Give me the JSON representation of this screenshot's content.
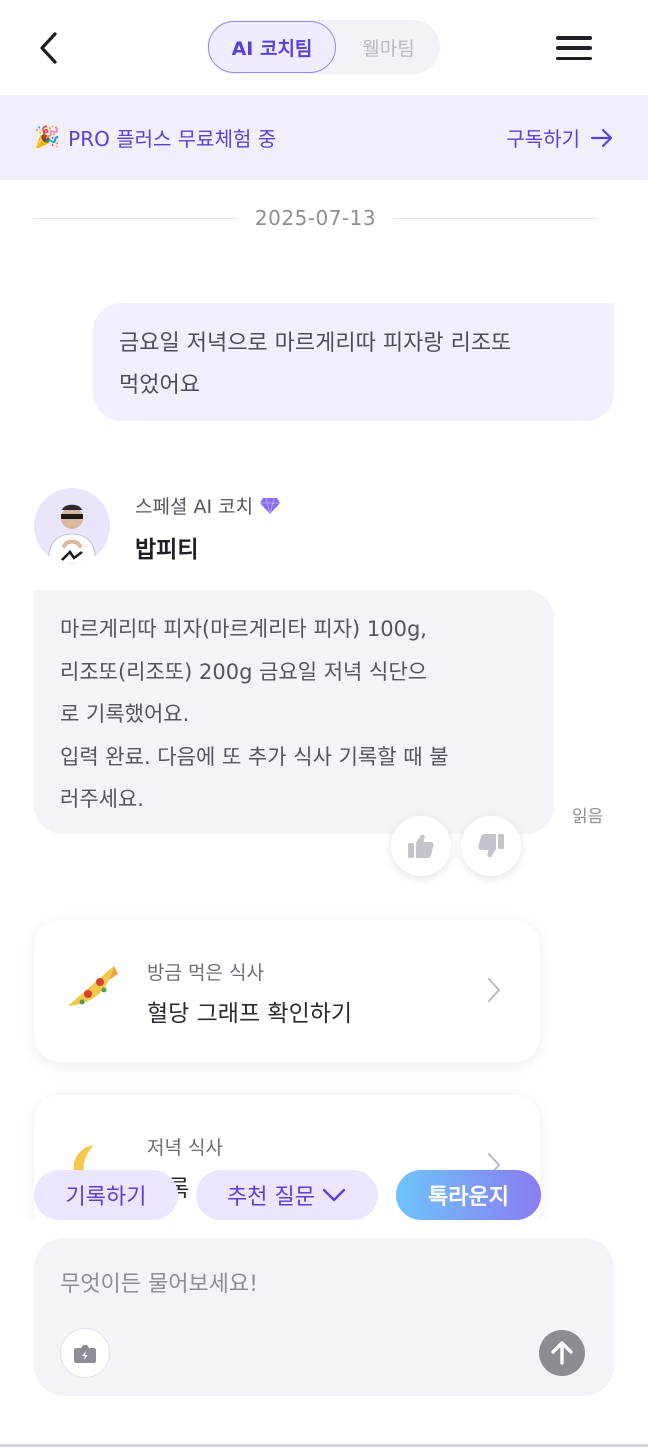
{
  "header": {
    "tabs": [
      {
        "label": "AI 코치팀",
        "active": true
      },
      {
        "label": "웰마팀",
        "active": false
      }
    ]
  },
  "promo": {
    "text": "PRO 플러스 무료체험 중",
    "action": "구독하기"
  },
  "chat": {
    "date": "2025-07-13",
    "user_message": [
      "금요일 저녁으로 마르게리따 피자랑 리조또",
      "먹었어요"
    ],
    "coach": {
      "subtitle": "스페셜 AI 코치",
      "name": "밥피티"
    },
    "ai_message": [
      "마르게리따 피자(마르게리타 피자) 100g,",
      "리조또(리조또) 200g 금요일 저녁 식단으",
      "로 기록했어요.",
      "입력 완료. 다음에 또 추가 식사 기록할 때 불",
      "러주세요."
    ],
    "read_label": "읽음"
  },
  "cards": [
    {
      "emoji": "🍕",
      "sub": "방금 먹은 식사",
      "title": "혈당 그래프 확인하기"
    },
    {
      "emoji": "🌙",
      "sub": "저녁 식사",
      "title": "기록"
    }
  ],
  "chips": {
    "record": "기록하기",
    "recommend": "추천 질문",
    "lounge": "톡라운지"
  },
  "input": {
    "placeholder": "무엇이든 물어보세요!"
  },
  "colors": {
    "accent": "#5b3fd6",
    "promo_bg": "#f1effc",
    "bubble_gray": "#f3f4f8"
  }
}
